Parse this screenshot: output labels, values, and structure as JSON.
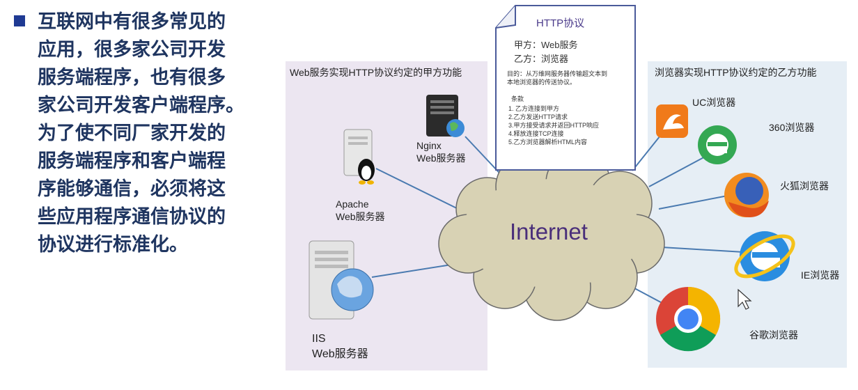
{
  "slide": {
    "bullet_text": "互联网中有很多常见的\n应用，很多家公司开发\n服务端程序，也有很多\n家公司开发客户端程序。\n为了使不同厂家开发的\n服务端程序和客户端程\n序能够通信，必须将这\n些应用程序通信协议的\n协议进行标准化。"
  },
  "diagram": {
    "left_caption": "Web服务实现HTTP协议约定的甲方功能",
    "right_caption": "浏览器实现HTTP协议约定的乙方功能",
    "center_label": "Internet",
    "servers": [
      {
        "label": "Nginx\nWeb服务器",
        "icon": "nginx-server-globe-icon"
      },
      {
        "label": "Apache\nWeb服务器",
        "icon": "apache-server-penguin-icon"
      },
      {
        "label": "IIS\nWeb服务器",
        "icon": "iis-server-globe-icon"
      }
    ],
    "browsers": [
      {
        "label": "UC浏览器",
        "icon": "uc-browser-icon"
      },
      {
        "label": "360浏览器",
        "icon": "360-browser-icon"
      },
      {
        "label": "火狐浏览器",
        "icon": "firefox-icon"
      },
      {
        "label": "IE浏览器",
        "icon": "ie-icon"
      },
      {
        "label": "谷歌浏览器",
        "icon": "chrome-icon"
      }
    ],
    "note": {
      "title": "HTTP协议",
      "party_a": "甲方：Web服务",
      "party_b": "乙方：浏览器",
      "purpose": "目的：从万维网服务器传输超文本到\n本地浏览器的传送协议。",
      "terms_title": "条款",
      "terms": "1. 乙方连接到甲方\n2.乙方发送HTTP请求\n3.甲方接受请求并返回HTTP响应\n4.释放连接TCP连接\n5.乙方浏览器解析HTML内容"
    }
  },
  "colors": {
    "bullet": "#1f3a93",
    "text": "#1f3560",
    "cloud": "#d8d2b4",
    "lines": "#4a7ab0",
    "left_panel": "#ece6f1",
    "right_panel": "#e6eef5"
  }
}
